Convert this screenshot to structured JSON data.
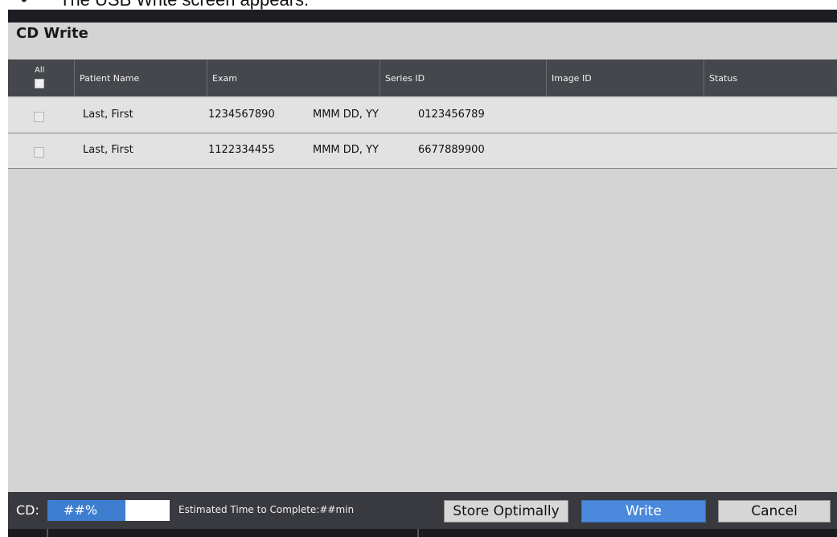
{
  "caption": {
    "bullet": "•",
    "text": "The USB Write screen appears."
  },
  "window": {
    "title": "CD Write"
  },
  "table": {
    "select_all_label": "All",
    "columns": [
      "Patient Name",
      "Exam",
      "Series ID",
      "Image ID",
      "Status"
    ],
    "rows": [
      {
        "patient_name": "Last, First",
        "exam": "1234567890",
        "date": "MMM DD, YY",
        "series_id": "0123456789",
        "image_id": "",
        "status": ""
      },
      {
        "patient_name": "Last, First",
        "exam": "1122334455",
        "date": "MMM DD, YY",
        "series_id": "6677889900",
        "image_id": "",
        "status": ""
      }
    ]
  },
  "footer": {
    "cd_label": "CD:",
    "progress_text": "##%",
    "progress_fraction": 0.64,
    "estimate_text": "Estimated Time to Complete:##min",
    "store_label": "Store Optimally",
    "write_label": "Write",
    "cancel_label": "Cancel"
  },
  "colors": {
    "accent": "#4a89dc",
    "header_bg": "#45474d",
    "footer_bg": "#393a3f"
  }
}
